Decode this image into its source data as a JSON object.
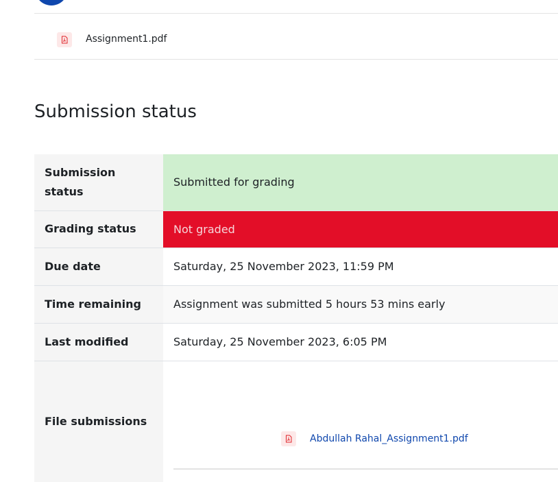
{
  "header": {
    "avatar": "user-avatar"
  },
  "intro_attachment": {
    "filename": "Assignment1.pdf",
    "icon": "pdf-file-icon"
  },
  "submission": {
    "heading": "Submission status",
    "rows": [
      {
        "label": "Submission status",
        "value": "Submitted for grading",
        "tone": "#cfefcf"
      },
      {
        "label": "Grading status",
        "value": "Not graded",
        "tone": "#e30e28"
      },
      {
        "label": "Due date",
        "value": "Saturday, 25 November 2023, 11:59 PM"
      },
      {
        "label": "Time remaining",
        "value": "Assignment was submitted 5 hours 53 mins early"
      },
      {
        "label": "Last modified",
        "value": "Saturday, 25 November 2023, 6:05 PM"
      }
    ],
    "file_submissions": {
      "label": "File submissions",
      "files": [
        {
          "name": "Abdullah Rahal_Assignment1.pdf",
          "icon": "pdf-file-icon"
        }
      ]
    }
  },
  "colors": {
    "link": "#0f47ad",
    "accent": "#0f47ad",
    "pdf_icon": "#e0262b"
  }
}
